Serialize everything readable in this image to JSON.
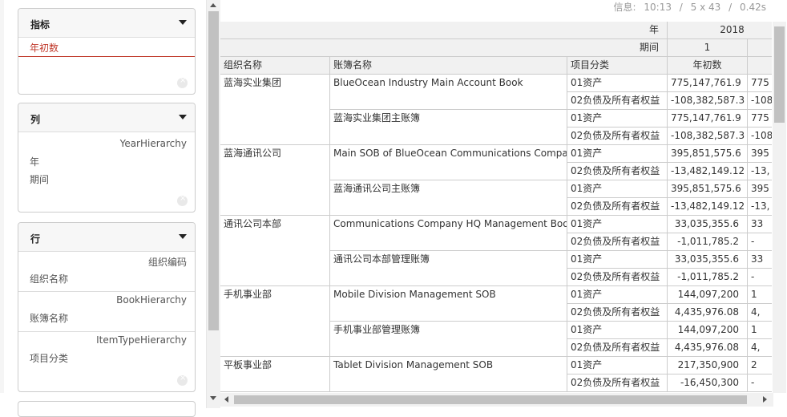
{
  "sidebar": {
    "indicator": {
      "title": "指标",
      "item": "年初数"
    },
    "columns": {
      "title": "列",
      "hierarchy": "YearHierarchy",
      "items": [
        "年",
        "期间"
      ]
    },
    "rows": {
      "title": "行",
      "groups": [
        {
          "hierarchy": "组织编码",
          "item": "组织名称"
        },
        {
          "hierarchy": "BookHierarchy",
          "item": "账簿名称"
        },
        {
          "hierarchy": "ItemTypeHierarchy",
          "item": "项目分类"
        }
      ]
    }
  },
  "info": {
    "label": "信息:",
    "time": "10:13",
    "size": "5 x 43",
    "duration": "0.42s"
  },
  "table": {
    "year_label": "年",
    "year_value": "2018",
    "period_label": "期间",
    "period_value": "1",
    "headers": [
      "组织名称",
      "账簿名称",
      "项目分类",
      "年初数"
    ],
    "orgs": [
      {
        "name": "蓝海实业集团",
        "books": [
          {
            "name": "BlueOcean Industry Main Account Book",
            "items": [
              [
                "01资产",
                "775,147,761.9",
                "775"
              ],
              [
                "02负债及所有者权益",
                "-108,382,587.3",
                "-108"
              ]
            ]
          },
          {
            "name": "蓝海实业集团主账簿",
            "items": [
              [
                "01资产",
                "775,147,761.9",
                "775"
              ],
              [
                "02负债及所有者权益",
                "-108,382,587.3",
                "-108"
              ]
            ]
          }
        ]
      },
      {
        "name": "蓝海通讯公司",
        "books": [
          {
            "name": "Main SOB of BlueOcean Communications Company",
            "items": [
              [
                "01资产",
                "395,851,575.6",
                "395"
              ],
              [
                "02负债及所有者权益",
                "-13,482,149.12",
                "-13,"
              ]
            ]
          },
          {
            "name": "蓝海通讯公司主账簿",
            "items": [
              [
                "01资产",
                "395,851,575.6",
                "395"
              ],
              [
                "02负债及所有者权益",
                "-13,482,149.12",
                "-13,"
              ]
            ]
          }
        ]
      },
      {
        "name": "通讯公司本部",
        "books": [
          {
            "name": "Communications Company HQ Management Book",
            "items": [
              [
                "01资产",
                "33,035,355.6",
                "33"
              ],
              [
                "02负债及所有者权益",
                "-1,011,785.2",
                "-"
              ]
            ]
          },
          {
            "name": "通讯公司本部管理账簿",
            "items": [
              [
                "01资产",
                "33,035,355.6",
                "33"
              ],
              [
                "02负债及所有者权益",
                "-1,011,785.2",
                "-"
              ]
            ]
          }
        ]
      },
      {
        "name": "手机事业部",
        "books": [
          {
            "name": "Mobile Division Management SOB",
            "items": [
              [
                "01资产",
                "144,097,200",
                "1"
              ],
              [
                "02负债及所有者权益",
                "4,435,976.08",
                "4,"
              ]
            ]
          },
          {
            "name": "手机事业部管理账簿",
            "items": [
              [
                "01资产",
                "144,097,200",
                "1"
              ],
              [
                "02负债及所有者权益",
                "4,435,976.08",
                "4,"
              ]
            ]
          }
        ]
      },
      {
        "name": "平板事业部",
        "books": [
          {
            "name": "Tablet Division Management SOB",
            "items": [
              [
                "01资产",
                "217,350,900",
                "2"
              ],
              [
                "02负债及所有者权益",
                "-16,450,300",
                "-"
              ]
            ]
          }
        ]
      }
    ]
  }
}
